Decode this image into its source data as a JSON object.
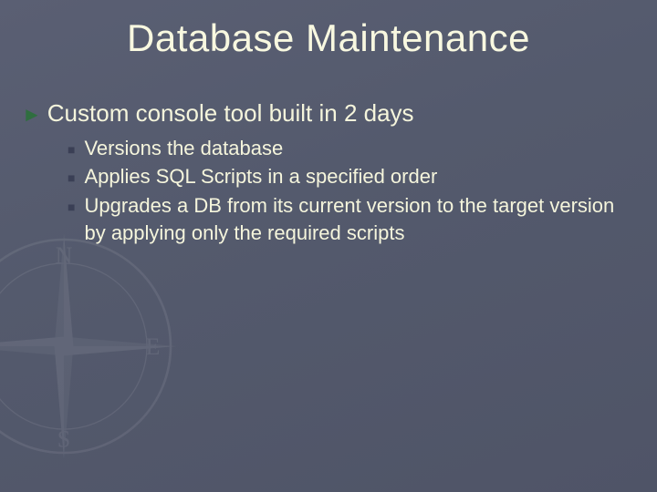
{
  "title": "Database Maintenance",
  "bullet1": "Custom console tool built in 2 days",
  "sub": {
    "a": "Versions the database",
    "b": "Applies SQL Scripts in a specified order",
    "c": "Upgrades a DB from its current version to the target version by applying only the required scripts"
  }
}
